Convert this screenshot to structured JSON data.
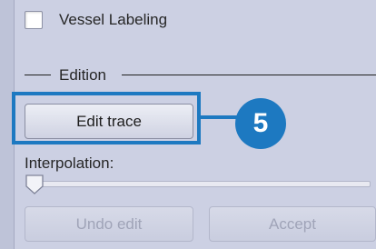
{
  "vessel_labeling": {
    "label": "Vessel Labeling",
    "checked": false
  },
  "edition_section": {
    "title": "Edition"
  },
  "buttons": {
    "edit_trace": "Edit trace",
    "undo_edit": "Undo edit",
    "accept": "Accept"
  },
  "callout": {
    "number": "5",
    "color": "#1d79c1"
  },
  "interpolation": {
    "label": "Interpolation:",
    "value_fraction": 0.0
  }
}
